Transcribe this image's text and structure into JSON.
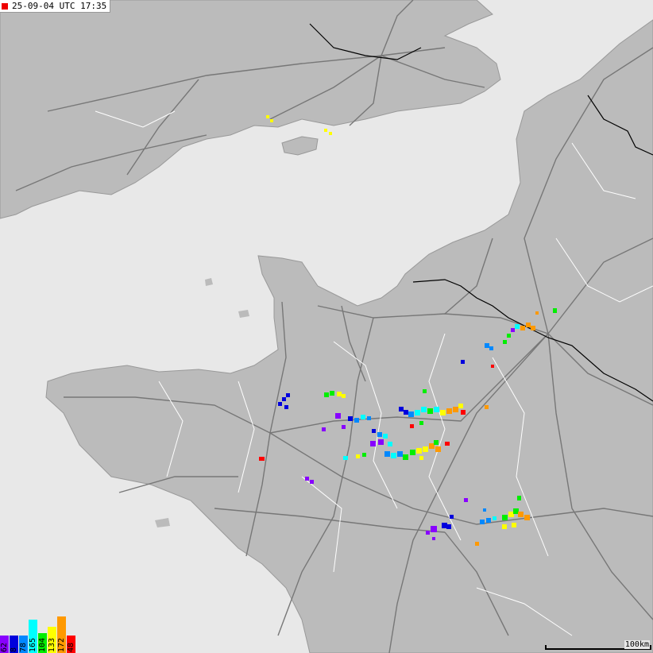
{
  "timestamp": {
    "text": "25-09-04 UTC 17:35",
    "marker_color": "#ee0000"
  },
  "legend": {
    "entries": [
      {
        "label": "62",
        "color": "#8800ff",
        "fraction": 0.16
      },
      {
        "label": "8",
        "color": "#0000dd",
        "fraction": 0.1
      },
      {
        "label": "78",
        "color": "#0088ff",
        "fraction": 0.24
      },
      {
        "label": "165",
        "color": "#00ffff",
        "fraction": 0.92
      },
      {
        "label": "104",
        "color": "#00ee00",
        "fraction": 0.55
      },
      {
        "label": "133",
        "color": "#ffff00",
        "fraction": 0.72
      },
      {
        "label": "172",
        "color": "#ff9900",
        "fraction": 1.0
      },
      {
        "label": "48",
        "color": "#ff0000",
        "fraction": 0.26
      }
    ]
  },
  "scale": {
    "label": "100km"
  },
  "colors": {
    "sea": "#e8e8e8",
    "land": "#bbbbbb",
    "roads": "#777777",
    "boundaries": "#ffffff",
    "borders": "#000000"
  }
}
